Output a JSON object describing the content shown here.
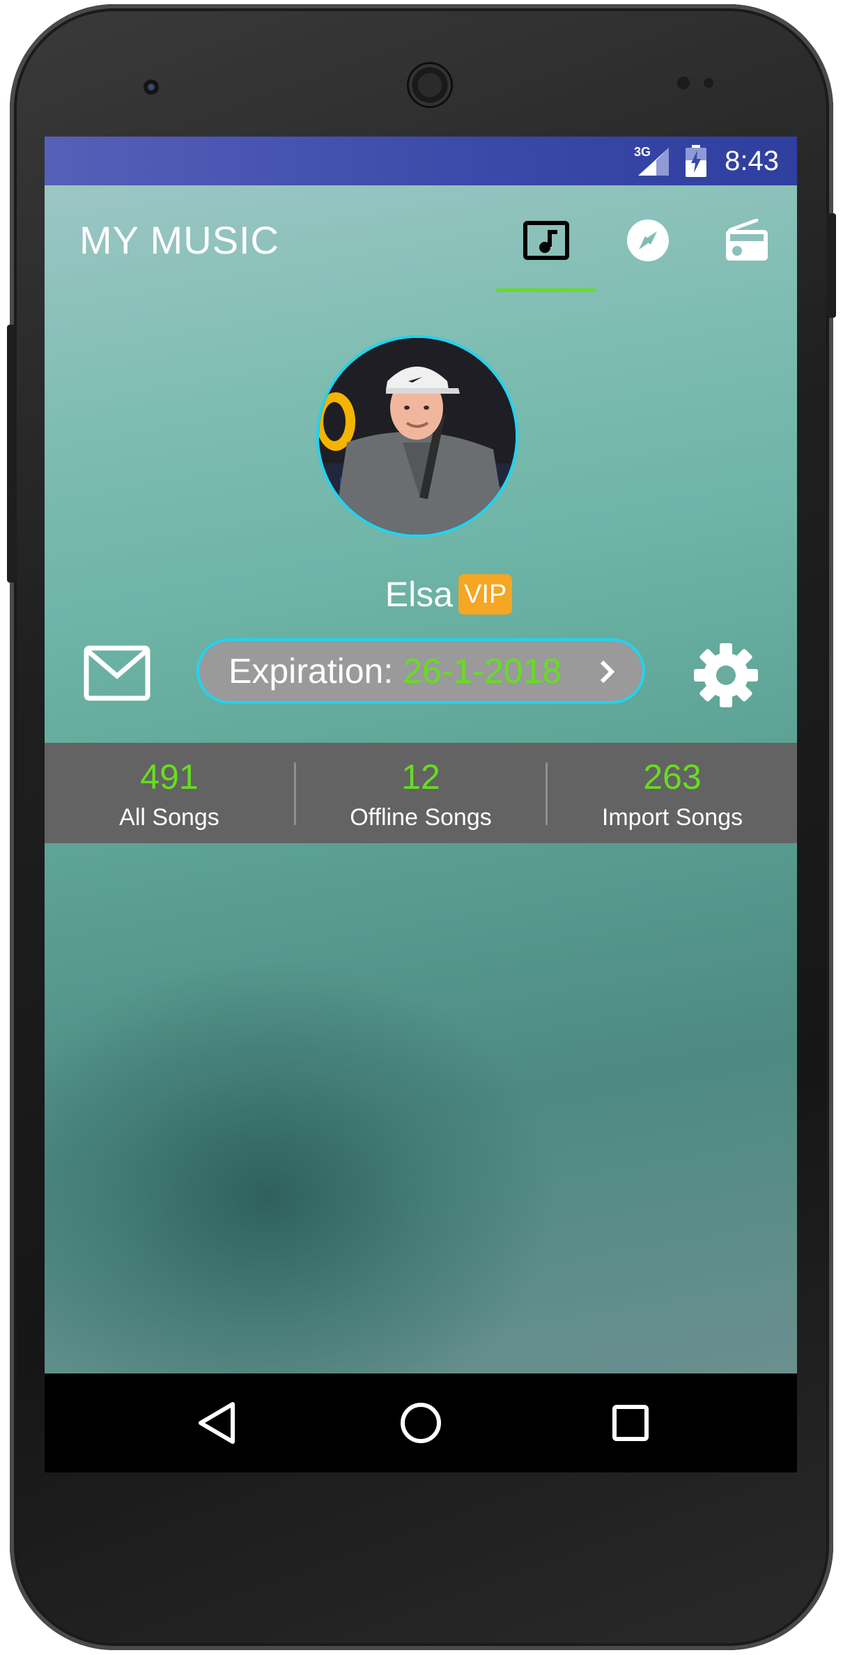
{
  "status_bar": {
    "network": "3G",
    "time": "8:43",
    "colors": {
      "background": "#3a48a8"
    }
  },
  "app": {
    "title": "MY MUSIC",
    "tabs": [
      {
        "icon": "music-note-icon",
        "active": true
      },
      {
        "icon": "compass-icon",
        "active": false
      },
      {
        "icon": "radio-icon",
        "active": false
      }
    ],
    "accent_color": "#66dd22"
  },
  "profile": {
    "name": "Elsa",
    "badge": "VIP",
    "badge_color": "#f5a623",
    "avatar_icon": "user-avatar",
    "expiration_label": "Expiration:",
    "expiration_date": "26-1-2018"
  },
  "stats": [
    {
      "value": "491",
      "label": "All Songs"
    },
    {
      "value": "12",
      "label": "Offline Songs"
    },
    {
      "value": "263",
      "label": "Import Songs"
    }
  ],
  "nav_bar": {
    "buttons": [
      "back-icon",
      "home-icon",
      "recents-icon"
    ]
  }
}
